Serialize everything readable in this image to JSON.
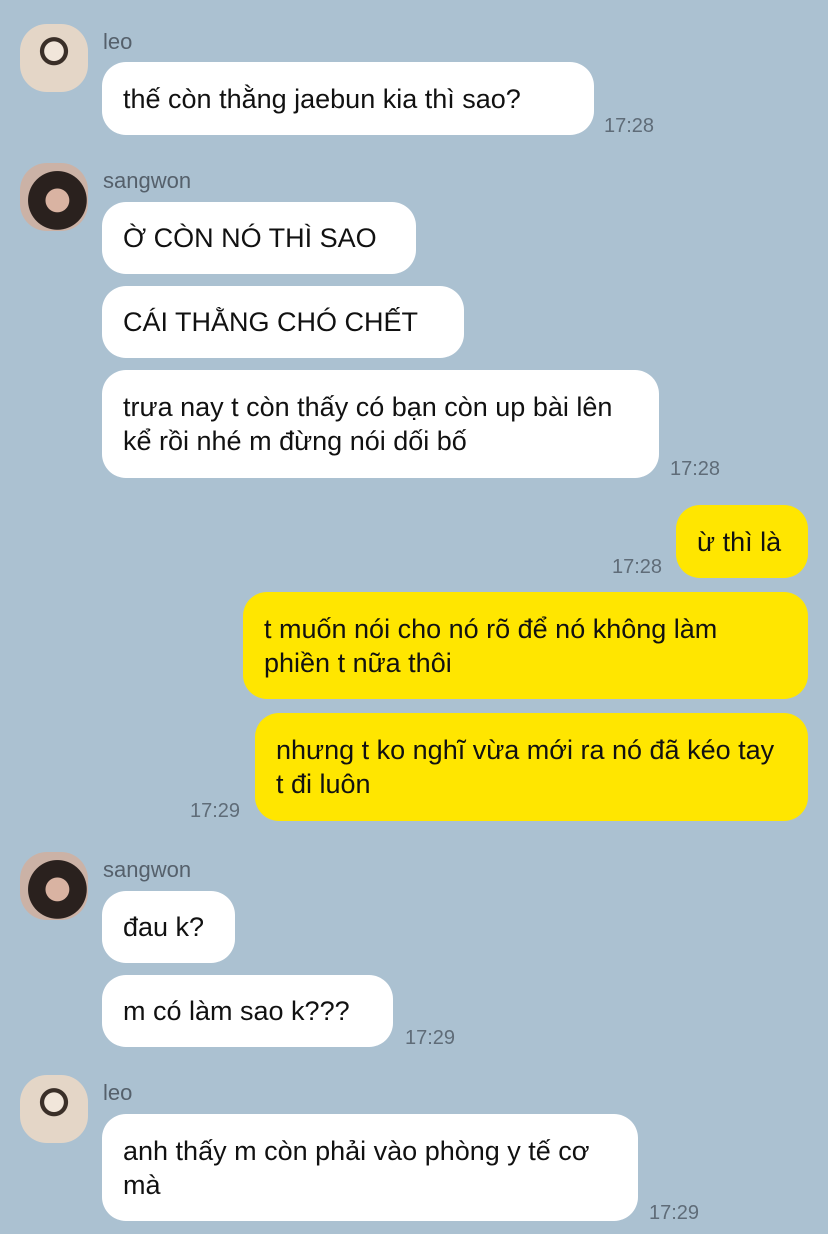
{
  "messages": [
    {
      "sender": "leo",
      "avatar": "leo",
      "texts": [
        "thế còn thằng jaebun kia thì sao?"
      ],
      "time": "17:28"
    },
    {
      "sender": "sangwon",
      "avatar": "sangwon",
      "texts": [
        "Ờ CÒN NÓ THÌ SAO",
        "CÁI THẰNG CHÓ CHẾT",
        "trưa nay t còn thấy có bạn còn up bài lên kể rồi nhé m đừng nói dối bố"
      ],
      "time": "17:28"
    },
    {
      "sender": "me",
      "texts": [
        "ừ thì là"
      ],
      "time": "17:28"
    },
    {
      "sender": "me",
      "texts": [
        "t muốn nói cho nó rõ để nó không làm phiền t nữa thôi",
        "nhưng t ko nghĩ vừa mới ra nó đã kéo tay t đi luôn"
      ],
      "time": "17:29"
    },
    {
      "sender": "sangwon",
      "avatar": "sangwon",
      "texts": [
        "đau k?",
        "m có làm sao k???"
      ],
      "time": "17:29"
    },
    {
      "sender": "leo",
      "avatar": "leo",
      "texts": [
        "anh thấy m còn phải vào phòng y tế cơ mà"
      ],
      "time": "17:29"
    }
  ]
}
